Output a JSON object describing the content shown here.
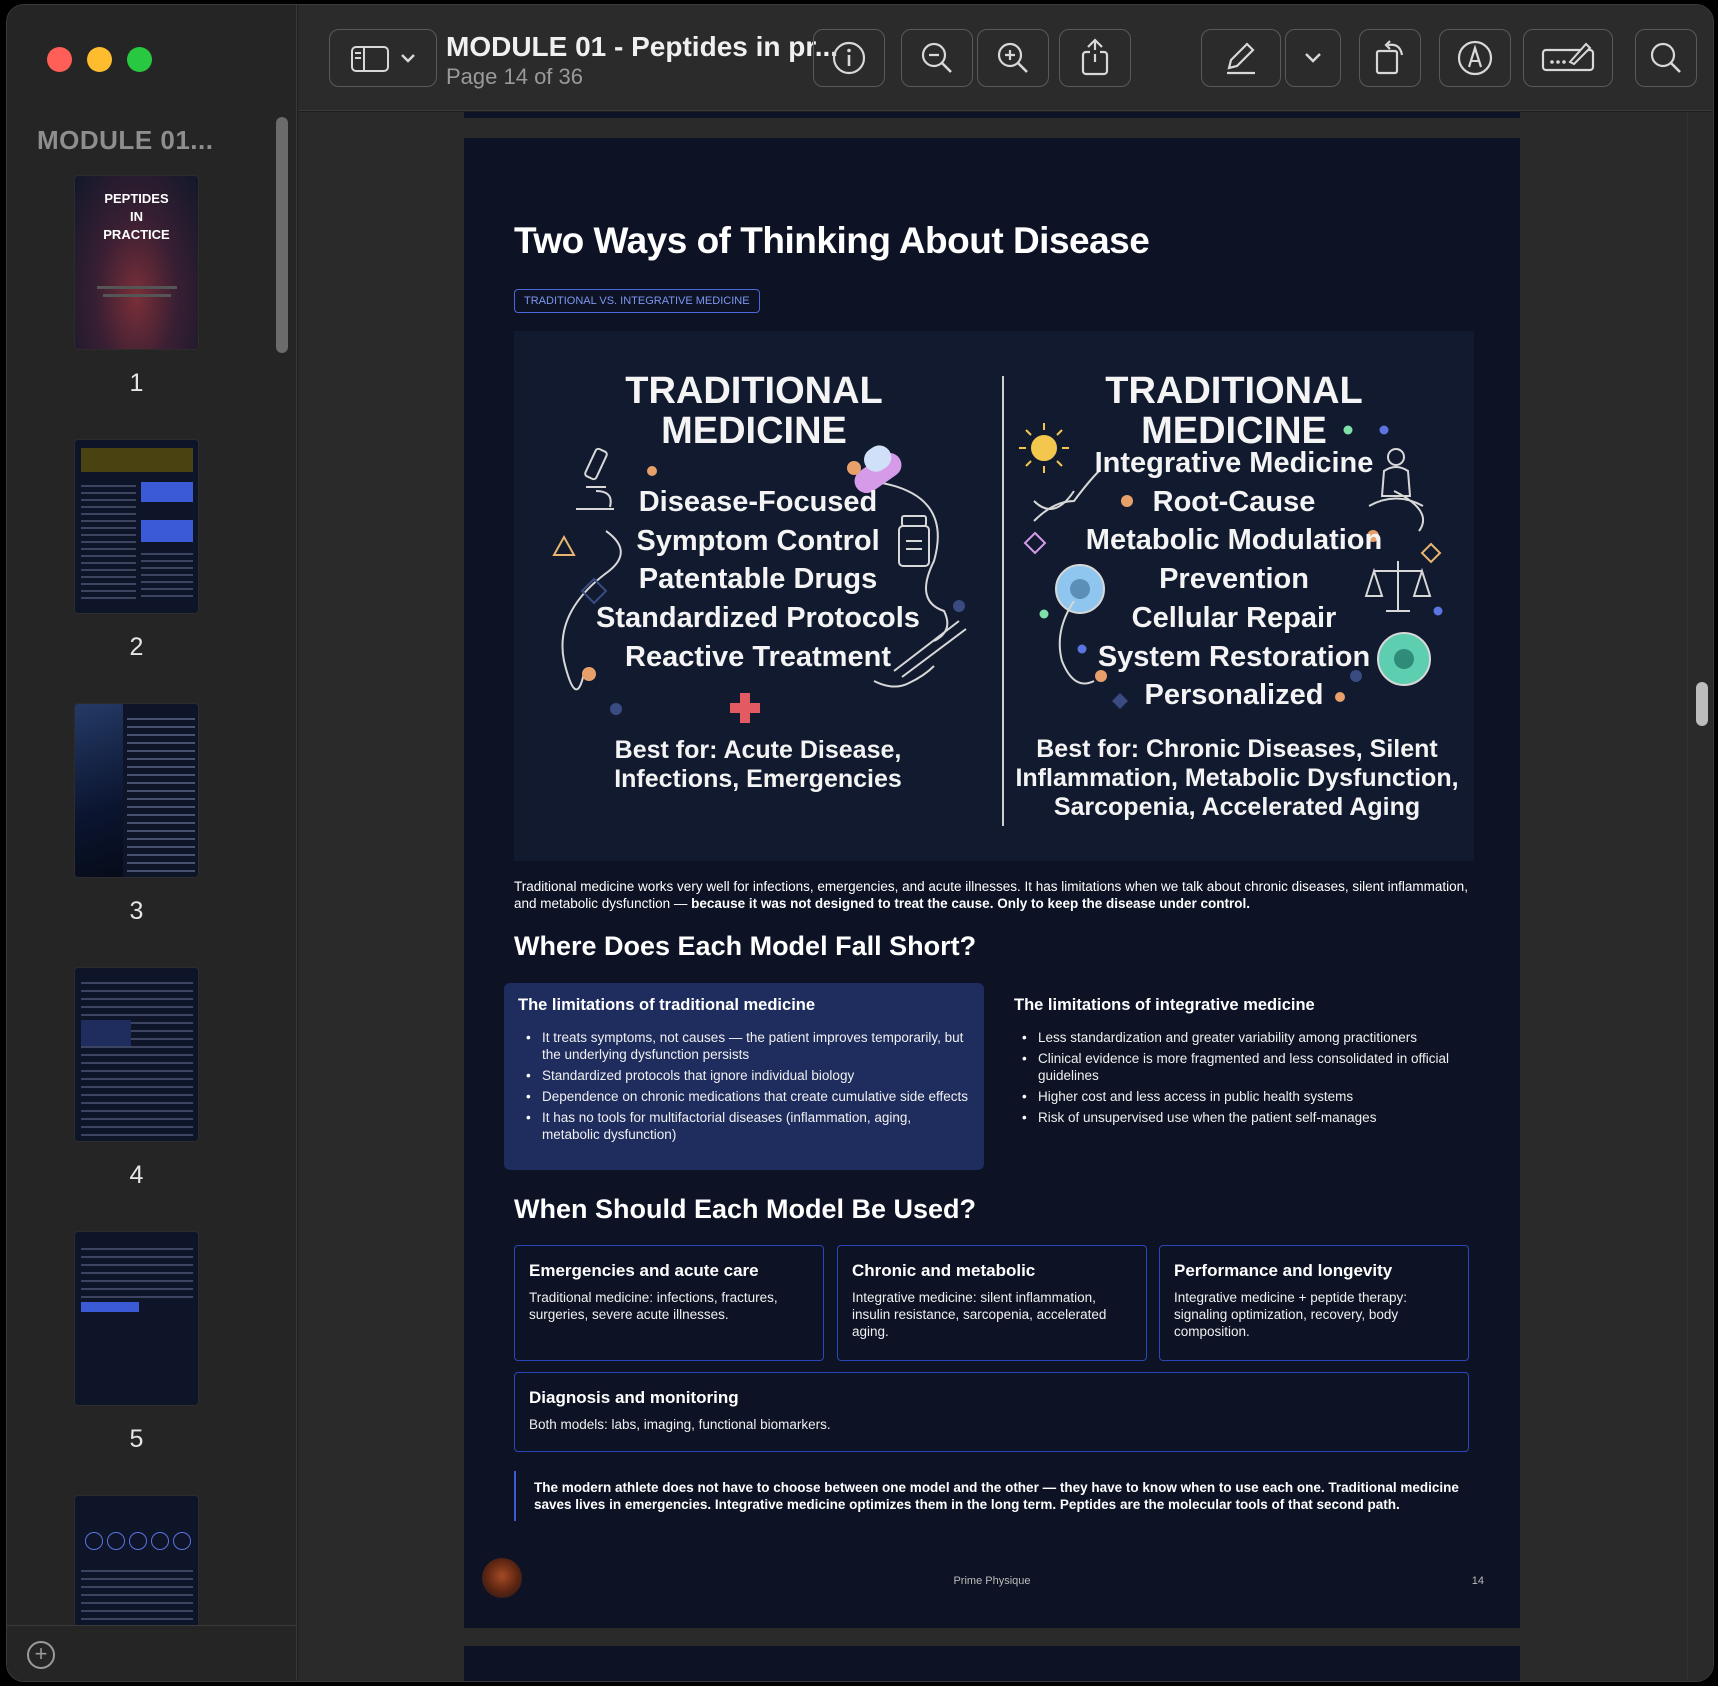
{
  "sidebar": {
    "title": "MODULE 01...",
    "thumbnails": [
      {
        "number": "1",
        "cover_text": "PEPTIDES IN PRACTICE"
      },
      {
        "number": "2"
      },
      {
        "number": "3"
      },
      {
        "number": "4"
      },
      {
        "number": "5"
      },
      {
        "number": ""
      }
    ]
  },
  "toolbar": {
    "title": "MODULE 01 - Peptides in pr...",
    "page_status": "Page 14 of 36",
    "buttons": [
      "sidebar-toggle",
      "info",
      "zoom-out",
      "zoom-in",
      "share",
      "markup-pen",
      "markup-menu",
      "rotate",
      "annotate",
      "signature",
      "search"
    ]
  },
  "page": {
    "title": "Two Ways of Thinking About Disease",
    "tag": "TRADITIONAL VS. INTEGRATIVE MEDICINE",
    "infographic": {
      "left": {
        "title_line1": "TRADITIONAL",
        "title_line2": "MEDICINE",
        "items": [
          "Disease-Focused",
          "Symptom Control",
          "Patentable Drugs",
          "Standardized Protocols",
          "Reactive Treatment"
        ],
        "best_for_line1": "Best for: Acute Disease,",
        "best_for_line2": "Infections, Emergencies"
      },
      "right": {
        "title_line1": "TRADITIONAL",
        "title_line2": "MEDICINE",
        "items": [
          "Integrative Medicine",
          "Root-Cause",
          "Metabolic Modulation",
          "Prevention",
          "Cellular Repair",
          "System Restoration",
          "Personalized"
        ],
        "best_for_line1": "Best for: Chronic Diseases, Silent",
        "best_for_line2": "Inflammation, Metabolic Dysfunction,",
        "best_for_line3": "Sarcopenia, Accelerated Aging"
      }
    },
    "intro_text": "Traditional medicine works very well for infections, emergencies, and acute illnesses. It has limitations when we talk about chronic diseases, silent inflammation, and metabolic dysfunction — ",
    "intro_bold": "because it was not designed to treat the cause. Only to keep the disease under control.",
    "section1_title": "Where Does Each Model Fall Short?",
    "limits_traditional": {
      "title": "The limitations of traditional medicine",
      "items": [
        "It treats symptoms, not causes — the patient improves temporarily, but the underlying dysfunction persists",
        "Standardized protocols that ignore individual biology",
        "Dependence on chronic medications that create cumulative side effects",
        "It has no tools for multifactorial diseases (inflammation, aging, metabolic dysfunction)"
      ]
    },
    "limits_integrative": {
      "title": "The limitations of integrative medicine",
      "items": [
        "Less standardization and greater variability among practitioners",
        "Clinical evidence is more fragmented and less consolidated in official guidelines",
        "Higher cost and less access in public health systems",
        "Risk of unsupervised use when the patient self-manages"
      ]
    },
    "section2_title": "When Should Each Model Be Used?",
    "cards": [
      {
        "title": "Emergencies and acute care",
        "text": "Traditional medicine: infections, fractures, surgeries, severe acute illnesses."
      },
      {
        "title": "Chronic and metabolic",
        "text": "Integrative medicine: silent inflammation, insulin resistance, sarcopenia, accelerated aging."
      },
      {
        "title": "Performance and longevity",
        "text": "Integrative medicine + peptide therapy: signaling optimization, recovery, body composition."
      },
      {
        "title": "Diagnosis and monitoring",
        "text": "Both models: labs, imaging, functional biomarkers."
      }
    ],
    "quote": "The modern athlete does not have to choose between one model and the other — they have to know when to use each one. Traditional medicine saves lives in emergencies. Integrative medicine optimizes them in the long term. Peptides are the molecular tools of that second path.",
    "footer_brand": "Prime Physique",
    "footer_page": "14"
  },
  "colors": {
    "page_bg": "#0d1324",
    "accent_blue": "#3b5bd6",
    "highlight_box": "#1f2d5e"
  }
}
